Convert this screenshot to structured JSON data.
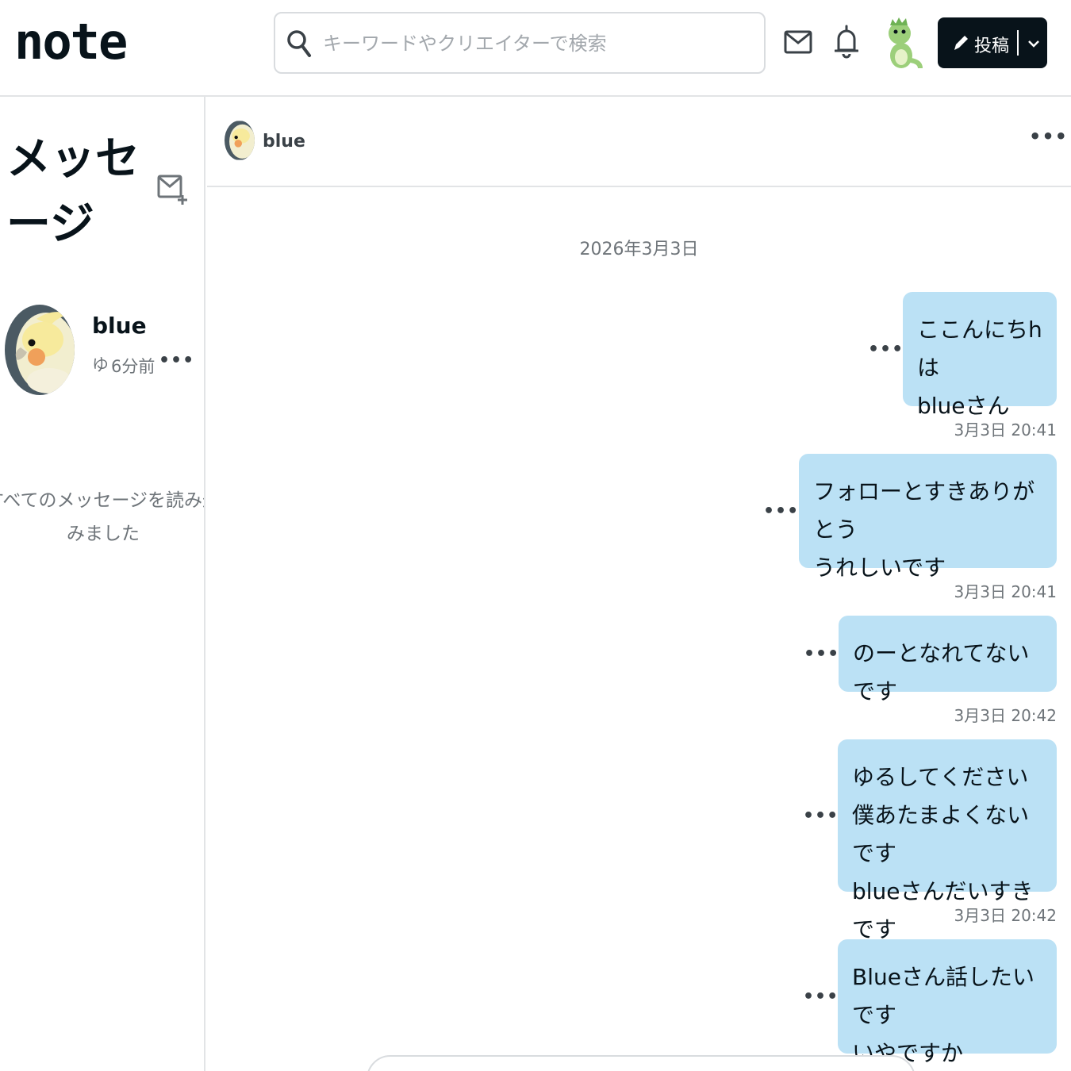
{
  "header": {
    "logo": "note",
    "search_placeholder": "キーワードやクリエイターで検索",
    "post_label": "投稿",
    "icons": [
      "mail-icon",
      "bell-icon",
      "user-avatar",
      "pencil-icon",
      "chevron-down-icon"
    ]
  },
  "sidebar": {
    "title": "メッセージ",
    "conversation": {
      "name": "blue",
      "preview": "ゆ",
      "time": "6分前"
    },
    "loaded_note": "すべてのメッセージを読み込みました"
  },
  "chat": {
    "partner_name": "blue",
    "date": "2026年3月3日",
    "messages": [
      {
        "text": "ここんにちhは\nblueさん",
        "time": "3月3日 20:41"
      },
      {
        "text": "フォローとすきありがとう\nうれしいです",
        "time": "3月3日 20:41"
      },
      {
        "text": "のーとなれてないです",
        "time": "3月3日 20:42"
      },
      {
        "text": "ゆるしてください\n僕あたまよくないです\nblueさんだいすきです",
        "time": "3月3日 20:42"
      },
      {
        "text": "Blueさん話したいです\nいやですか",
        "time": ""
      }
    ]
  },
  "colors": {
    "bubble": "#bbe1f5",
    "primary": "#08131a",
    "muted": "#6e7479",
    "border": "#e2e4e6"
  }
}
